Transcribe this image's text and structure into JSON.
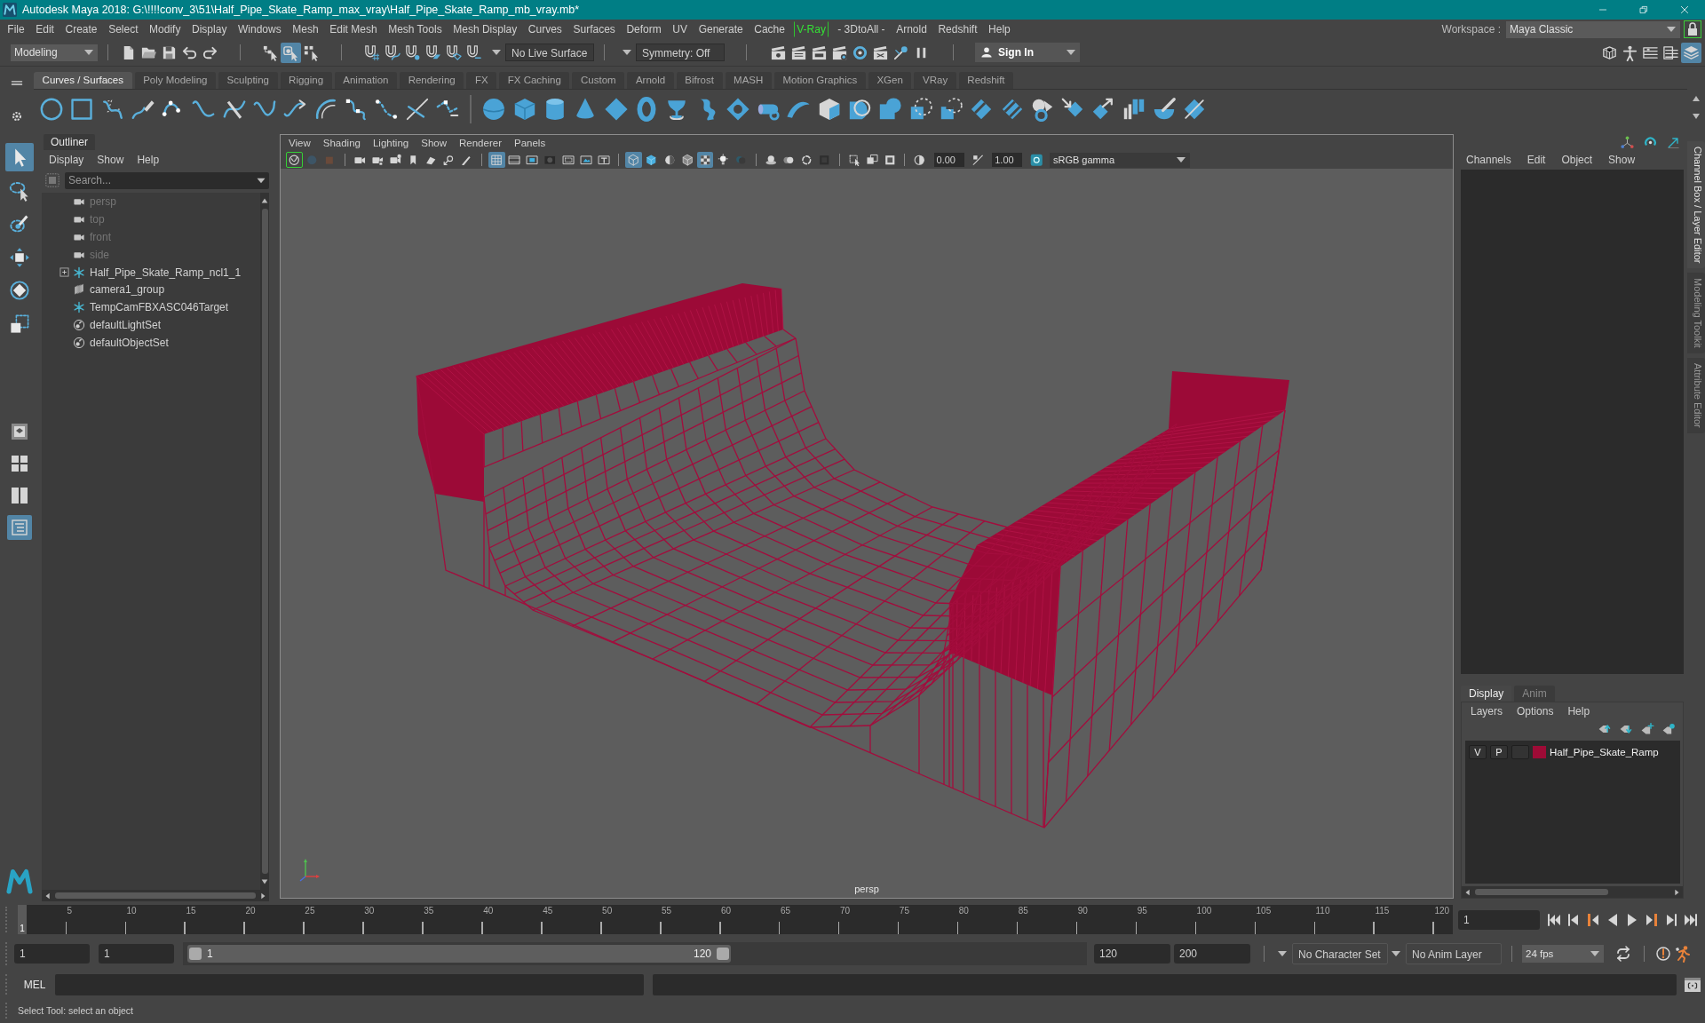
{
  "window": {
    "title": "Autodesk Maya 2018: G:\\!!!!conv_3\\51\\Half_Pipe_Skate_Ramp_max_vray\\Half_Pipe_Skate_Ramp_mb_vray.mb*"
  },
  "menu_bar": {
    "items": [
      {
        "label": "File",
        "kind": "plain"
      },
      {
        "label": "Edit",
        "kind": "plain"
      },
      {
        "label": "Create",
        "kind": "plain"
      },
      {
        "label": "Select",
        "kind": "plain"
      },
      {
        "label": "Modify",
        "kind": "plain"
      },
      {
        "label": "Display",
        "kind": "plain"
      },
      {
        "label": "Windows",
        "kind": "plain"
      },
      {
        "label": "Mesh",
        "kind": "plain"
      },
      {
        "label": "Edit Mesh",
        "kind": "plain"
      },
      {
        "label": "Mesh Tools",
        "kind": "plain"
      },
      {
        "label": "Mesh Display",
        "kind": "plain"
      },
      {
        "label": "Curves",
        "kind": "plain"
      },
      {
        "label": "Surfaces",
        "kind": "plain"
      },
      {
        "label": "Deform",
        "kind": "plain"
      },
      {
        "label": "UV",
        "kind": "plain"
      },
      {
        "label": "Generate",
        "kind": "plain"
      },
      {
        "label": "Cache",
        "kind": "plain"
      },
      {
        "label": "V-Ray",
        "kind": "boxed"
      },
      {
        "label": "- 3DtoAll -",
        "kind": "plain"
      },
      {
        "label": "Arnold",
        "kind": "plain"
      },
      {
        "label": "Redshift",
        "kind": "plain"
      },
      {
        "label": "Help",
        "kind": "plain"
      }
    ],
    "workspace_label": "Workspace :",
    "workspace": "Maya Classic"
  },
  "status_line": {
    "mode": "Modeling",
    "selection_modes": [
      {
        "kind": "hierarchy",
        "selected": false
      },
      {
        "kind": "object",
        "selected": true
      },
      {
        "kind": "component",
        "selected": false
      }
    ],
    "live_surface": "No Live Surface",
    "symmetry": "Symmetry: Off",
    "sign_in": "Sign In",
    "panel_toggles": [
      {
        "kind": "modeling-toolkit",
        "on": false
      },
      {
        "kind": "character-controls",
        "on": false
      },
      {
        "kind": "attribute-editor",
        "on": false
      },
      {
        "kind": "tool-settings",
        "on": false
      },
      {
        "kind": "channel-box",
        "on": true
      }
    ]
  },
  "shelf": {
    "tabs": [
      {
        "label": "Curves / Surfaces",
        "selected": true
      },
      {
        "label": "Poly Modeling",
        "selected": false
      },
      {
        "label": "Sculpting",
        "selected": false
      },
      {
        "label": "Rigging",
        "selected": false
      },
      {
        "label": "Animation",
        "selected": false
      },
      {
        "label": "Rendering",
        "selected": false
      },
      {
        "label": "FX",
        "selected": false
      },
      {
        "label": "FX Caching",
        "selected": false
      },
      {
        "label": "Custom",
        "selected": false
      },
      {
        "label": "Arnold",
        "selected": false
      },
      {
        "label": "Bifrost",
        "selected": false
      },
      {
        "label": "MASH",
        "selected": false
      },
      {
        "label": "Motion Graphics",
        "selected": false
      },
      {
        "label": "XGen",
        "selected": false
      },
      {
        "label": "VRay",
        "selected": false
      },
      {
        "label": "Redshift",
        "selected": false
      }
    ]
  },
  "toolbox": {
    "tools": [
      {
        "kind": "select",
        "selected": true
      },
      {
        "kind": "lasso",
        "selected": false
      },
      {
        "kind": "paint",
        "selected": false
      },
      {
        "kind": "move",
        "selected": false
      },
      {
        "kind": "rotate",
        "selected": false
      },
      {
        "kind": "scale",
        "selected": false
      }
    ],
    "layouts": [
      {
        "kind": "single",
        "selected": false
      },
      {
        "kind": "four",
        "selected": false
      },
      {
        "kind": "two",
        "selected": false
      },
      {
        "kind": "outliner",
        "selected": true
      }
    ]
  },
  "outliner": {
    "title": "Outliner",
    "menu": [
      "Display",
      "Show",
      "Help"
    ],
    "search_placeholder": "Search...",
    "items": [
      {
        "label": "persp",
        "kind": "camera",
        "dimmed": true,
        "expandable": false
      },
      {
        "label": "top",
        "kind": "camera",
        "dimmed": true,
        "expandable": false
      },
      {
        "label": "front",
        "kind": "camera",
        "dimmed": true,
        "expandable": false
      },
      {
        "label": "side",
        "kind": "camera",
        "dimmed": true,
        "expandable": false
      },
      {
        "label": "Half_Pipe_Skate_Ramp_ncl1_1",
        "kind": "transform",
        "dimmed": false,
        "expandable": true
      },
      {
        "label": "camera1_group",
        "kind": "group",
        "dimmed": false,
        "expandable": false
      },
      {
        "label": "TempCamFBXASC046Target",
        "kind": "transform",
        "dimmed": false,
        "expandable": false
      },
      {
        "label": "defaultLightSet",
        "kind": "set",
        "dimmed": false,
        "expandable": false
      },
      {
        "label": "defaultObjectSet",
        "kind": "set",
        "dimmed": false,
        "expandable": false
      }
    ]
  },
  "viewport": {
    "menu": [
      "View",
      "Shading",
      "Lighting",
      "Show",
      "Renderer",
      "Panels"
    ],
    "toolbar": [
      {
        "kind": "camera-select",
        "on": true
      },
      {
        "kind": "sphere-dim",
        "on": false
      },
      {
        "kind": "box-dim",
        "on": false
      },
      {
        "kind": "camera",
        "on": false
      },
      {
        "kind": "camera-lock",
        "on": false
      },
      {
        "kind": "camera-bookmark",
        "on": false
      },
      {
        "kind": "bookmark",
        "on": false
      },
      {
        "kind": "image-plane",
        "on": false
      },
      {
        "kind": "pan-zoom",
        "on": false
      },
      {
        "kind": "pencil",
        "on": false
      },
      {
        "kind": "grid",
        "on": true
      },
      {
        "kind": "film-gate",
        "on": false
      },
      {
        "kind": "resolution-gate",
        "on": false
      },
      {
        "kind": "gate-mask",
        "on": false
      },
      {
        "kind": "field-chart",
        "on": false
      },
      {
        "kind": "safe-action",
        "on": false
      },
      {
        "kind": "safe-title",
        "on": false
      },
      {
        "kind": "wireframe",
        "on": true
      },
      {
        "kind": "smooth-shade",
        "on": false
      },
      {
        "kind": "default-material",
        "on": false
      },
      {
        "kind": "wire-on-shaded",
        "on": false
      },
      {
        "kind": "xray",
        "on": true
      },
      {
        "kind": "lights",
        "on": false
      },
      {
        "kind": "shadows",
        "on": false
      },
      {
        "kind": "ambient-occlusion",
        "on": false
      },
      {
        "kind": "motion-blur",
        "on": false
      },
      {
        "kind": "anti-aliasing",
        "on": false
      },
      {
        "kind": "depth-of-field",
        "on": false
      },
      {
        "kind": "isolate",
        "on": false
      },
      {
        "kind": "xray-joints",
        "on": false
      },
      {
        "kind": "xray-components",
        "on": false
      }
    ],
    "exposure": "0.00",
    "gamma": "1.00",
    "view_transform": "sRGB gamma",
    "camera_label": "persp"
  },
  "channel_box": {
    "menu": [
      "Channels",
      "Edit",
      "Object",
      "Show"
    ]
  },
  "layer_editor": {
    "tabs": [
      {
        "label": "Display",
        "selected": true
      },
      {
        "label": "Anim",
        "selected": false
      }
    ],
    "menu": [
      "Layers",
      "Options",
      "Help"
    ],
    "layers": [
      {
        "visibility": "V",
        "playback": "P",
        "name": "Half_Pipe_Skate_Ramp",
        "color": "#9e0b36"
      }
    ]
  },
  "side_tabs": [
    {
      "label": "Channel Box / Layer Editor",
      "selected": true
    },
    {
      "label": "Modeling Toolkit",
      "selected": false
    },
    {
      "label": "Attribute Editor",
      "selected": false
    }
  ],
  "time_slider": {
    "ticks": [
      "5",
      "10",
      "15",
      "20",
      "25",
      "30",
      "35",
      "40",
      "45",
      "50",
      "55",
      "60",
      "65",
      "70",
      "75",
      "80",
      "85",
      "90",
      "95",
      "100",
      "105",
      "110",
      "115",
      "120"
    ],
    "playhead": "1",
    "level": 0,
    "current_frame": "1"
  },
  "range_slider": {
    "start": "1",
    "range_start": "1",
    "range_start_label": "1",
    "range_end_label": "120",
    "range_end": "120",
    "end": "200",
    "character_set": "No Character Set",
    "anim_layer": "No Anim Layer",
    "fps": "24 fps"
  },
  "command_line": {
    "language": "MEL"
  },
  "help_line": "Select Tool: select an object"
}
